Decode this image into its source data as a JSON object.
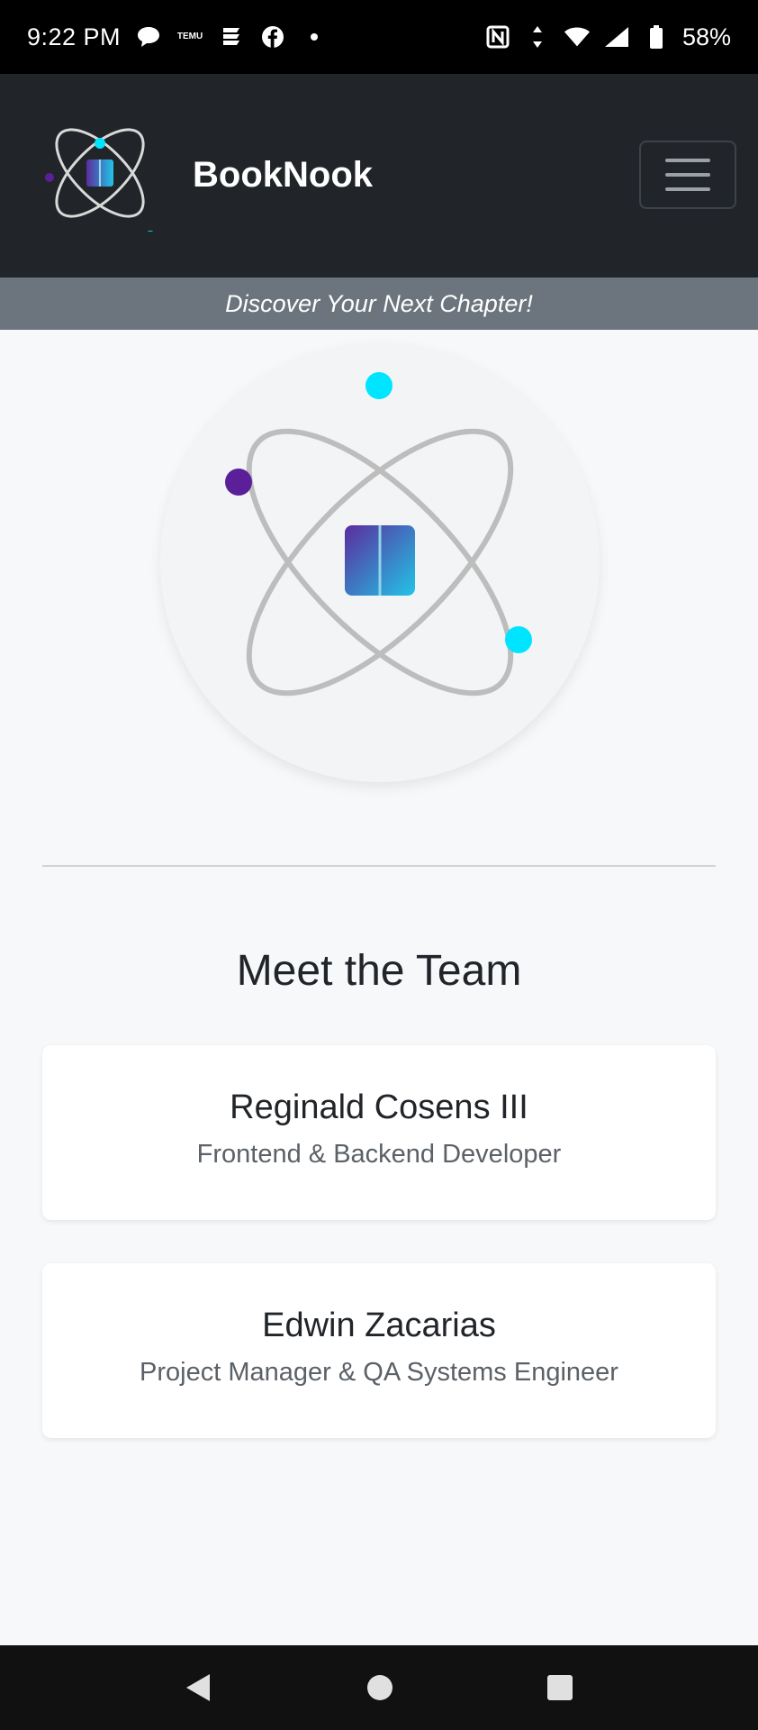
{
  "status_bar": {
    "time": "9:22 PM",
    "battery": "58%",
    "icons": [
      "chat-bubble-icon",
      "temu-app-icon",
      "news-app-icon",
      "facebook-icon",
      "dot-icon",
      "nfc-icon",
      "data-arrows-icon",
      "wifi-icon",
      "signal-icon",
      "battery-icon"
    ],
    "temu_label": "TEMU"
  },
  "navbar": {
    "brand": "BookNook",
    "toggler_icon": "hamburger-menu-icon"
  },
  "tagline": "Discover Your Next Chapter!",
  "hero": {
    "icon": "atom-book-logo",
    "colors": {
      "book_start": "#5b2c9e",
      "book_end": "#22c4e6",
      "dot_cyan": "#00e5ff",
      "dot_purple": "#5b1f9a"
    }
  },
  "team": {
    "title": "Meet the Team",
    "members": [
      {
        "name": "Reginald Cosens III",
        "role": "Frontend & Backend Developer"
      },
      {
        "name": "Edwin Zacarias",
        "role": "Project Manager & QA Systems Engineer"
      }
    ]
  },
  "system_nav": {
    "icons": [
      "back-icon",
      "home-icon",
      "recents-icon"
    ]
  }
}
